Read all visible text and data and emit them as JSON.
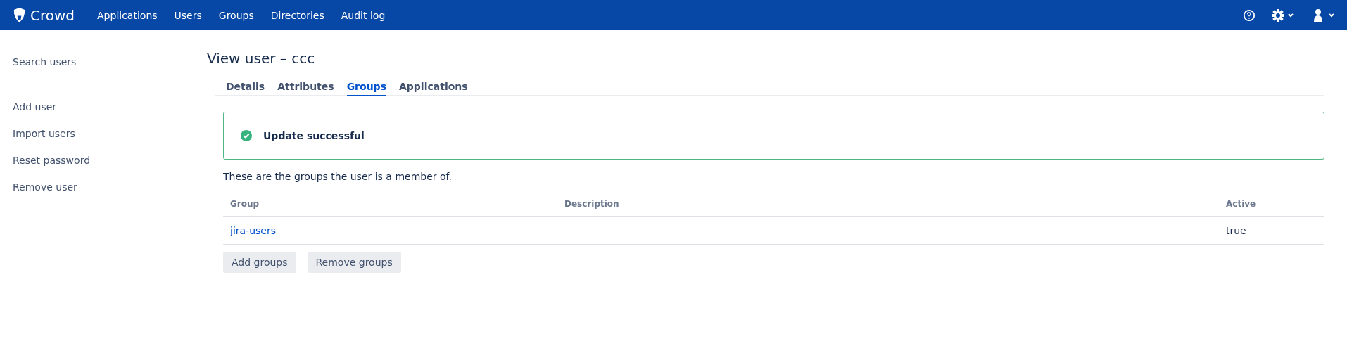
{
  "header": {
    "logo": "Crowd",
    "nav": [
      {
        "label": "Applications",
        "selected": false
      },
      {
        "label": "Users",
        "selected": false
      },
      {
        "label": "Groups",
        "selected": false
      },
      {
        "label": "Directories",
        "selected": false
      },
      {
        "label": "Audit log",
        "selected": false
      }
    ]
  },
  "sidebar": {
    "items": [
      {
        "label": "Search users",
        "selected": false
      },
      {
        "label": "Add user",
        "selected": false
      },
      {
        "label": "Import users",
        "selected": false
      },
      {
        "label": "Reset password",
        "selected": false
      },
      {
        "label": "Remove user",
        "selected": false
      }
    ]
  },
  "title": "View user – ccc",
  "tabs": [
    {
      "label": "Details",
      "selected": false
    },
    {
      "label": "Attributes",
      "selected": false
    },
    {
      "label": "Groups",
      "selected": true
    },
    {
      "label": "Applications",
      "selected": false
    }
  ],
  "message": {
    "kind": "success",
    "text": "Update successful"
  },
  "intro": "These are the groups the user is a member of.",
  "table": {
    "columns": [
      "Group",
      "Description",
      "Active"
    ],
    "rows": [
      {
        "group": "jira-users",
        "active": "true"
      }
    ]
  },
  "buttons": [
    "Add groups",
    "Remove groups"
  ]
}
